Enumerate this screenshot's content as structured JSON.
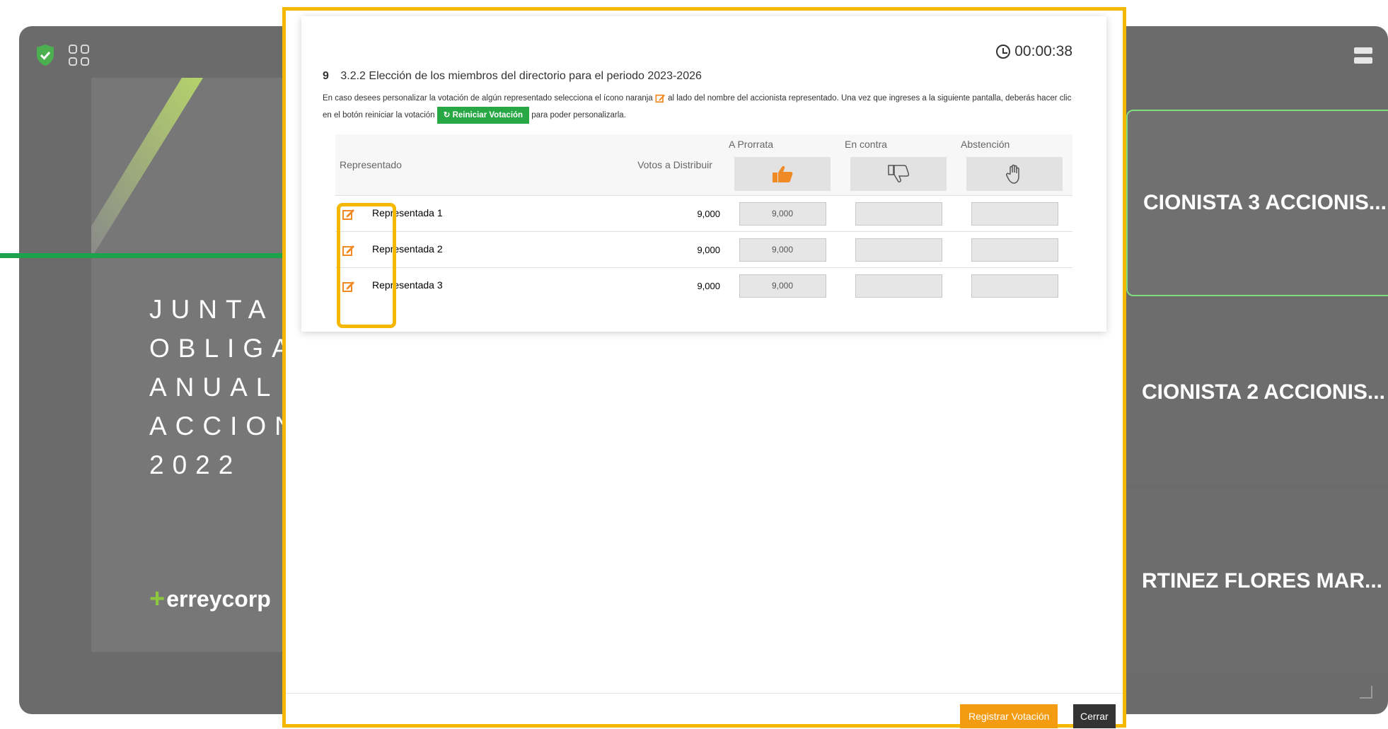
{
  "background": {
    "title_lines": [
      "JUNTA G",
      "OBLIGAT",
      "ANUAL D",
      "ACCIONI",
      "2022"
    ],
    "logo_text": "erreycorp",
    "participants": [
      {
        "name": "CIONISTA 3 ACCIONIS..."
      },
      {
        "name": "CIONISTA 2 ACCIONIS..."
      },
      {
        "name": "RTINEZ FLORES MAR..."
      }
    ]
  },
  "modal": {
    "timer": "00:00:38",
    "question_number": "9",
    "question_title": "3.2.2 Elección de los miembros del directorio para el periodo 2023-2026",
    "instruction_part1": "En caso desees personalizar la votación de algún representado selecciona el ícono naranja",
    "instruction_part2": "al lado del nombre del accionista representado. Una vez que ingreses a la siguiente pantalla, deberás hacer clic en el botón reiniciar la votación",
    "reset_button": "Reiniciar Votación",
    "instruction_part3": "para poder personalizarla.",
    "columns": {
      "representado": "Representado",
      "votos": "Votos a Distribuir",
      "prorrata": "A Prorrata",
      "contra": "En contra",
      "abstencion": "Abstención"
    },
    "rows": [
      {
        "name": "Representada 1",
        "votos": "9,000",
        "prorrata": "9,000",
        "contra": "",
        "abstencion": ""
      },
      {
        "name": "Representada 2",
        "votos": "9,000",
        "prorrata": "9,000",
        "contra": "",
        "abstencion": ""
      },
      {
        "name": "Representada 3",
        "votos": "9,000",
        "prorrata": "9,000",
        "contra": "",
        "abstencion": ""
      }
    ],
    "register_button": "Registrar Votación",
    "close_button": "Cerrar"
  },
  "colors": {
    "highlight": "#f4b800",
    "arrow": "#1aa34a",
    "orange": "#f08a24",
    "reset_green": "#28a745"
  }
}
